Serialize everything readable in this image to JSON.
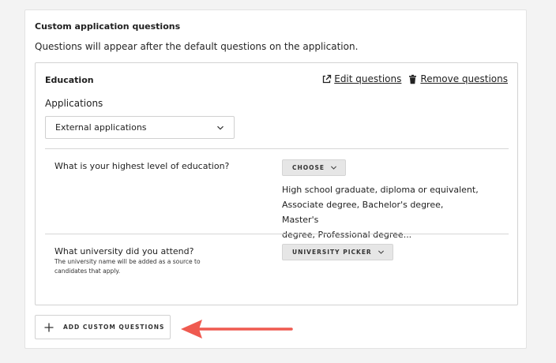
{
  "section": {
    "title": "Custom application questions",
    "subtitle": "Questions will appear after the default questions on the application."
  },
  "question_set": {
    "title": "Education",
    "edit_label": "Edit questions",
    "remove_label": "Remove questions",
    "applications_label": "Applications",
    "applications_value": "External applications",
    "questions": [
      {
        "text": "What is your highest level of education?",
        "control_label": "CHOOSE",
        "options_preview": [
          "High school graduate, diploma or equivalent,",
          "Associate degree, Bachelor's degree, Master's",
          "degree, Professional degree..."
        ]
      },
      {
        "text": "What university did you attend?",
        "hint": "The university name will be added as a source to candidates that apply.",
        "control_label": "UNIVERSITY PICKER"
      }
    ]
  },
  "add_button_label": "ADD CUSTOM QUESTIONS",
  "icons": [
    "external-link-icon",
    "trash-icon",
    "chevron-down-icon",
    "plus-icon",
    "arrow-left-icon"
  ],
  "colors": {
    "annotation_arrow": "#ef5a50"
  }
}
